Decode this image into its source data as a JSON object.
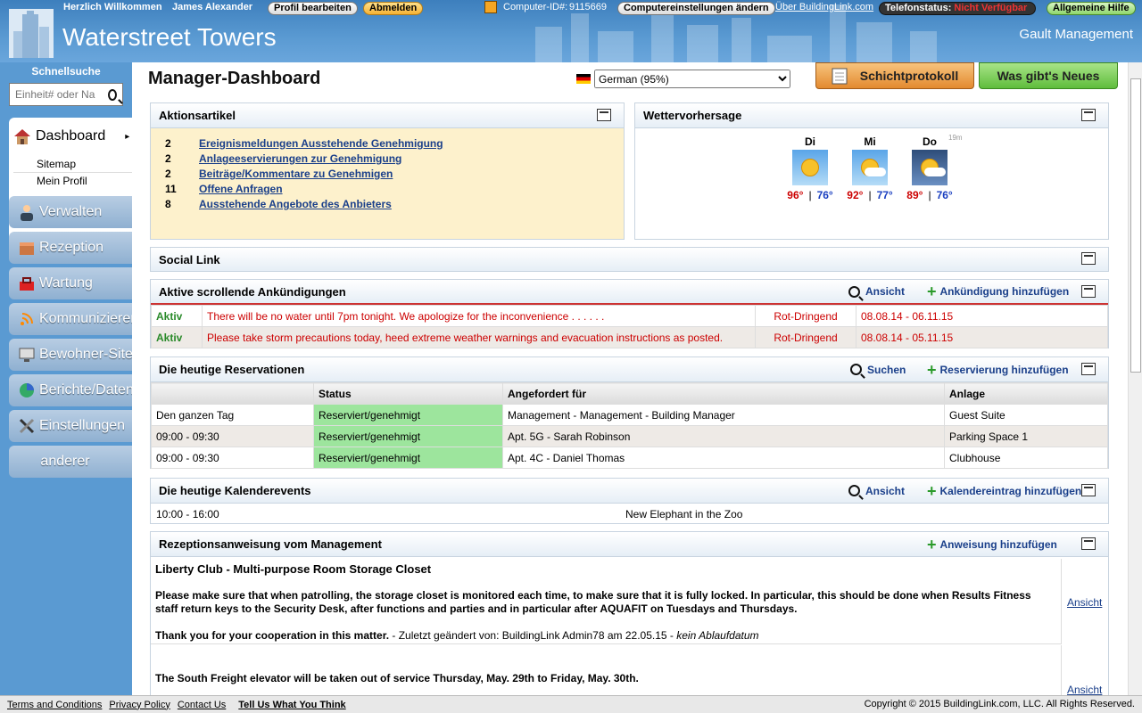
{
  "header": {
    "welcome": "Herzlich Willkommen",
    "user": "James Alexander",
    "edit_profile": "Profil bearbeiten",
    "logout": "Abmelden",
    "computer_id_label": "Computer-ID#:",
    "computer_id": "9115669",
    "computer_settings": "Computereinstellungen ändern",
    "about": "Über BuildingLink.com",
    "phone_status_label": "Telefonstatus:",
    "phone_status": "Nicht Verfügbar",
    "help": "Allgemeine Hilfe",
    "site_title": "Waterstreet Towers",
    "company": "Gault Management"
  },
  "sidebar": {
    "quicksearch_label": "Schnellsuche",
    "quicksearch_placeholder": "Einheit# oder Na",
    "dashboard": "Dashboard",
    "sub": [
      "Sitemap",
      "Mein Profil"
    ],
    "items": [
      "Verwalten",
      "Rezeption",
      "Wartung",
      "Kommunizieren",
      "Bewohner-Site",
      "Berichte/Daten",
      "Einstellungen",
      "anderer"
    ]
  },
  "main": {
    "title": "Manager-Dashboard",
    "language": "German (95%)",
    "shift_log": "Schichtprotokoll",
    "whats_new": "Was gibt's Neues"
  },
  "action_items": {
    "title": "Aktionsartikel",
    "rows": [
      {
        "count": "2",
        "label": "Ereignismeldungen Ausstehende Genehmigung"
      },
      {
        "count": "2",
        "label": "Anlageeservierungen zur Genehmigung"
      },
      {
        "count": "2",
        "label": "Beiträge/Kommentare zu Genehmigen"
      },
      {
        "count": "11",
        "label": "Offene Anfragen"
      },
      {
        "count": "8",
        "label": "Ausstehende Angebote des Anbieters"
      }
    ]
  },
  "weather": {
    "title": "Wettervorhersage",
    "age": "19m",
    "days": [
      {
        "day": "Di",
        "hi": "96°",
        "lo": "76°"
      },
      {
        "day": "Mi",
        "hi": "92°",
        "lo": "77°"
      },
      {
        "day": "Do",
        "hi": "89°",
        "lo": "76°"
      }
    ],
    "sep": "|"
  },
  "social": {
    "title": "Social Link"
  },
  "announcements": {
    "title": "Aktive scrollende Ankündigungen",
    "view": "Ansicht",
    "add": "Ankündigung hinzufügen",
    "rows": [
      {
        "status": "Aktiv",
        "text": "There will be no water until 7pm tonight. We apologize for the inconvenience . . . . . .",
        "priority": "Rot-Dringend",
        "dates": "08.08.14 - 06.11.15"
      },
      {
        "status": "Aktiv",
        "text": "Please take storm precautions today, heed extreme weather warnings and evacuation instructions as posted.",
        "priority": "Rot-Dringend",
        "dates": "08.08.14 - 05.11.15"
      }
    ]
  },
  "reservations": {
    "title": "Die heutige Reservationen",
    "search": "Suchen",
    "add": "Reservierung hinzufügen",
    "headers": [
      "",
      "Status",
      "Angefordert für",
      "Anlage"
    ],
    "rows": [
      {
        "time": "Den ganzen Tag",
        "status": "Reserviert/genehmigt",
        "for": "Management - Management - Building Manager",
        "facility": "Guest Suite"
      },
      {
        "time": "09:00 - 09:30",
        "status": "Reserviert/genehmigt",
        "for": "Apt. 5G - Sarah Robinson",
        "facility": "Parking Space 1"
      },
      {
        "time": "09:00 - 09:30",
        "status": "Reserviert/genehmigt",
        "for": "Apt. 4C - Daniel Thomas",
        "facility": "Clubhouse"
      }
    ]
  },
  "calendar": {
    "title": "Die heutige Kalenderevents",
    "view": "Ansicht",
    "add": "Kalendereintrag hinzufügen",
    "rows": [
      {
        "time": "10:00 - 16:00",
        "event": "New Elephant in the Zoo"
      }
    ]
  },
  "instructions": {
    "title": "Rezeptionsanweisung vom Management",
    "add": "Anweisung hinzufügen",
    "view": "Ansicht",
    "items": [
      {
        "heading": "Liberty Club - Multi-purpose Room Storage Closet",
        "body": "Please make sure that when patrolling, the storage closet is monitored each time, to make sure that it is fully locked. In particular, this should be done when Results Fitness staff return keys to the Security Desk, after functions and parties and in particular after AQUAFIT on Tuesdays and Thursdays.",
        "thanks": "Thank you for your cooperation in this matter.",
        "changed": " - Zuletzt geändert von: BuildingLink Admin78 am 22.05.15 - ",
        "expiry": "kein Ablaufdatum"
      },
      {
        "body": "The South Freight elevator will be taken out of service Thursday, May. 29th  to Friday, May. 30th."
      }
    ]
  },
  "footer": {
    "links": [
      "Terms and Conditions",
      "Privacy Policy",
      "Contact Us",
      "Tell Us What You Think"
    ],
    "copyright": "Copyright © 2015 BuildingLink.com, LLC.   All Rights Reserved."
  },
  "colors": {
    "header_blue": "#4a8bc8",
    "sidebar_blue": "#5a9ad2",
    "action_bg": "#fdf1cc",
    "urgent_red": "#cc0000",
    "approved_green": "#9de59d"
  }
}
